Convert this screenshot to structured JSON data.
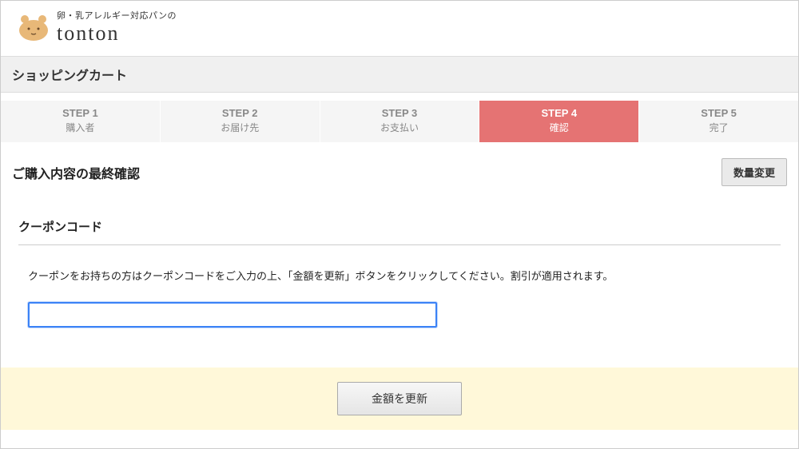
{
  "header": {
    "tagline": "卵・乳アレルギー対応パンの",
    "brand": "tonton"
  },
  "page_title": "ショッピングカート",
  "steps": [
    {
      "num": "STEP 1",
      "label": "購入者"
    },
    {
      "num": "STEP 2",
      "label": "お届け先"
    },
    {
      "num": "STEP 3",
      "label": "お支払い"
    },
    {
      "num": "STEP 4",
      "label": "確認"
    },
    {
      "num": "STEP 5",
      "label": "完了"
    }
  ],
  "active_step_index": 3,
  "confirmation": {
    "title": "ご購入内容の最終確認",
    "qty_change_label": "数量変更"
  },
  "coupon": {
    "title": "クーポンコード",
    "instruction": "クーポンをお持ちの方はクーポンコードをご入力の上、「金額を更新」ボタンをクリックしてください。割引が適用されます。",
    "input_value": "",
    "update_label": "金額を更新"
  }
}
